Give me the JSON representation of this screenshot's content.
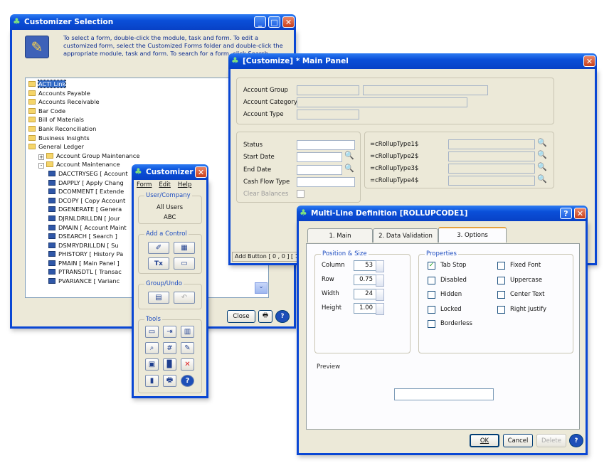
{
  "selection": {
    "title": "Customizer Selection",
    "instructions": "To select a form, double-click the module, task and form. To edit a customized form, select the Customized Forms folder and double-click the appropriate module, task and form. To search for a form, click Search.",
    "tree": [
      {
        "label": "ACTI Link",
        "kind": "folder",
        "level": 0,
        "selected": true
      },
      {
        "label": "Accounts Payable",
        "kind": "folder",
        "level": 0
      },
      {
        "label": "Accounts Receivable",
        "kind": "folder",
        "level": 0
      },
      {
        "label": "Bar Code",
        "kind": "folder",
        "level": 0
      },
      {
        "label": "Bill of Materials",
        "kind": "folder",
        "level": 0
      },
      {
        "label": "Bank Reconciliation",
        "kind": "folder",
        "level": 0
      },
      {
        "label": "Business Insights",
        "kind": "folder",
        "level": 0
      },
      {
        "label": "General Ledger",
        "kind": "folder",
        "level": 0
      },
      {
        "label": "Account Group Maintenance",
        "kind": "folder",
        "level": 1,
        "toggle": "+"
      },
      {
        "label": "Account Maintenance",
        "kind": "folder",
        "level": 1,
        "toggle": "-"
      },
      {
        "label": "DACCTRYSEG  [ Account",
        "kind": "form",
        "level": 2
      },
      {
        "label": "DAPPLY  [ Apply Chang",
        "kind": "form",
        "level": 2
      },
      {
        "label": "DCOMMENT  [ Extende",
        "kind": "form",
        "level": 2
      },
      {
        "label": "DCOPY  [ Copy Account",
        "kind": "form",
        "level": 2
      },
      {
        "label": "DGENERATE  [ Genera",
        "kind": "form",
        "level": 2
      },
      {
        "label": "DJRNLDRILLDN  [ Jour",
        "kind": "form",
        "level": 2
      },
      {
        "label": "DMAIN  [ Account Maint",
        "kind": "form",
        "level": 2
      },
      {
        "label": "DSEARCH  [ Search ]",
        "kind": "form",
        "level": 2
      },
      {
        "label": "DSMRYDRILLDN  [ Su",
        "kind": "form",
        "level": 2
      },
      {
        "label": "PHISTORY  [ History Pa",
        "kind": "form",
        "level": 2
      },
      {
        "label": "PMAIN  [ Main Panel ]",
        "kind": "form",
        "level": 2
      },
      {
        "label": "PTRANSDTL  [ Transac",
        "kind": "form",
        "level": 2
      },
      {
        "label": "PVARIANCE  [ Varianc",
        "kind": "form",
        "level": 2
      }
    ],
    "close_label": "Close"
  },
  "main_panel": {
    "title": "[Customize] * Main Panel",
    "labels": {
      "account_group": "Account Group",
      "account_category": "Account Category",
      "account_type": "Account Type",
      "status": "Status",
      "start_date": "Start Date",
      "end_date": "End Date",
      "cash_flow_type": "Cash Flow Type",
      "clear_balances": "Clear Balances"
    },
    "rollups": [
      "=cRollupType1$",
      "=cRollupType2$",
      "=cRollupType3$",
      "=cRollupType4$"
    ],
    "status_text": "Add Button [ 0 , 0 ] [ 1"
  },
  "toolbox": {
    "title": "Customizer",
    "menu": [
      "Form",
      "Edit",
      "Help"
    ],
    "user_company_title": "User/Company",
    "user": "All Users",
    "company": "ABC",
    "add_control_title": "Add a Control",
    "group_undo_title": "Group/Undo",
    "tools_title": "Tools"
  },
  "mld": {
    "title": "Multi-Line Definition  [ROLLUPCODE1]",
    "tabs": [
      "1. Main",
      "2. Data Validation",
      "3. Options"
    ],
    "active_tab": 2,
    "position_size_title": "Position & Size",
    "fields": [
      {
        "label": "Column",
        "value": "53"
      },
      {
        "label": "Row",
        "value": "0.75"
      },
      {
        "label": "Width",
        "value": "24"
      },
      {
        "label": "Height",
        "value": "1.00"
      }
    ],
    "properties_title": "Properties",
    "props_left": [
      {
        "label": "Tab Stop",
        "checked": true
      },
      {
        "label": "Disabled",
        "checked": false
      },
      {
        "label": "Hidden",
        "checked": false
      },
      {
        "label": "Locked",
        "checked": false
      },
      {
        "label": "Borderless",
        "checked": false
      }
    ],
    "props_right": [
      {
        "label": "Fixed Font",
        "checked": false
      },
      {
        "label": "Uppercase",
        "checked": false
      },
      {
        "label": "Center Text",
        "checked": false
      },
      {
        "label": "Right Justify",
        "checked": false
      }
    ],
    "preview_label": "Preview",
    "ok_label": "OK",
    "cancel_label": "Cancel",
    "delete_label": "Delete"
  }
}
